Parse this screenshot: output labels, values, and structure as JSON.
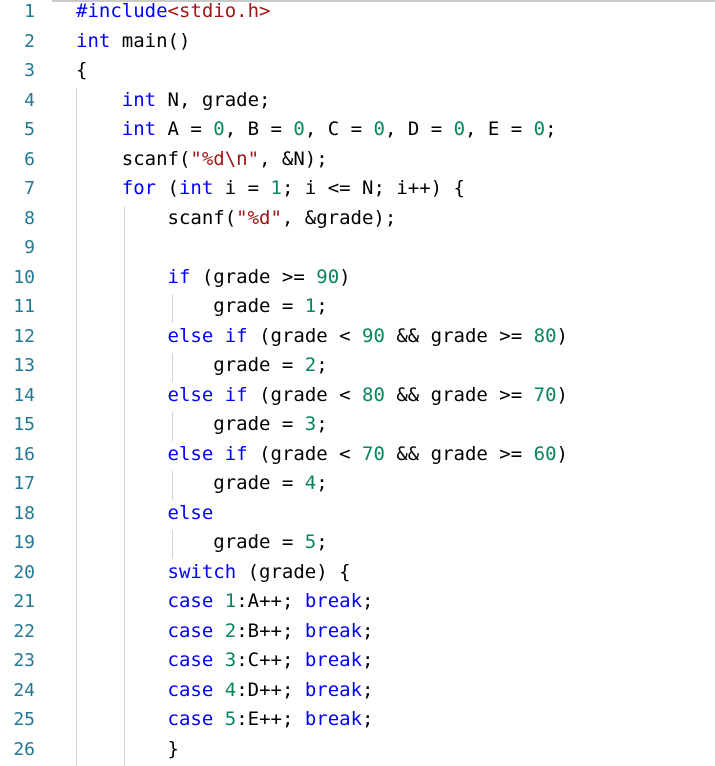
{
  "editor": {
    "lines": [
      {
        "n": "1",
        "tokens": [
          {
            "t": "#include",
            "c": "pp"
          },
          {
            "t": "<stdio.h>",
            "c": "str"
          }
        ]
      },
      {
        "n": "2",
        "tokens": [
          {
            "t": "int",
            "c": "kw"
          },
          {
            "t": " main()",
            "c": "fn"
          }
        ]
      },
      {
        "n": "3",
        "tokens": [
          {
            "t": "{",
            "c": "fn"
          }
        ]
      },
      {
        "n": "4",
        "tokens": [
          {
            "t": "    ",
            "c": "fn"
          },
          {
            "t": "int",
            "c": "kw"
          },
          {
            "t": " N, grade;",
            "c": "fn"
          }
        ]
      },
      {
        "n": "5",
        "tokens": [
          {
            "t": "    ",
            "c": "fn"
          },
          {
            "t": "int",
            "c": "kw"
          },
          {
            "t": " A = ",
            "c": "fn"
          },
          {
            "t": "0",
            "c": "num"
          },
          {
            "t": ", B = ",
            "c": "fn"
          },
          {
            "t": "0",
            "c": "num"
          },
          {
            "t": ", C = ",
            "c": "fn"
          },
          {
            "t": "0",
            "c": "num"
          },
          {
            "t": ", D = ",
            "c": "fn"
          },
          {
            "t": "0",
            "c": "num"
          },
          {
            "t": ", E = ",
            "c": "fn"
          },
          {
            "t": "0",
            "c": "num"
          },
          {
            "t": ";",
            "c": "fn"
          }
        ]
      },
      {
        "n": "6",
        "tokens": [
          {
            "t": "    scanf(",
            "c": "fn"
          },
          {
            "t": "\"%d\\n\"",
            "c": "str"
          },
          {
            "t": ", &N);",
            "c": "fn"
          }
        ]
      },
      {
        "n": "7",
        "tokens": [
          {
            "t": "    ",
            "c": "fn"
          },
          {
            "t": "for",
            "c": "kw"
          },
          {
            "t": " (",
            "c": "fn"
          },
          {
            "t": "int",
            "c": "kw"
          },
          {
            "t": " i = ",
            "c": "fn"
          },
          {
            "t": "1",
            "c": "num"
          },
          {
            "t": "; i <= N; i++) {",
            "c": "fn"
          }
        ]
      },
      {
        "n": "8",
        "tokens": [
          {
            "t": "        scanf(",
            "c": "fn"
          },
          {
            "t": "\"%d\"",
            "c": "str"
          },
          {
            "t": ", &grade);",
            "c": "fn"
          }
        ]
      },
      {
        "n": "9",
        "tokens": []
      },
      {
        "n": "10",
        "tokens": [
          {
            "t": "        ",
            "c": "fn"
          },
          {
            "t": "if",
            "c": "kw"
          },
          {
            "t": " (grade >= ",
            "c": "fn"
          },
          {
            "t": "90",
            "c": "num"
          },
          {
            "t": ")",
            "c": "fn"
          }
        ]
      },
      {
        "n": "11",
        "tokens": [
          {
            "t": "            grade = ",
            "c": "fn"
          },
          {
            "t": "1",
            "c": "num"
          },
          {
            "t": ";",
            "c": "fn"
          }
        ]
      },
      {
        "n": "12",
        "tokens": [
          {
            "t": "        ",
            "c": "fn"
          },
          {
            "t": "else",
            "c": "kw"
          },
          {
            "t": " ",
            "c": "fn"
          },
          {
            "t": "if",
            "c": "kw"
          },
          {
            "t": " (grade < ",
            "c": "fn"
          },
          {
            "t": "90",
            "c": "num"
          },
          {
            "t": " && grade >= ",
            "c": "fn"
          },
          {
            "t": "80",
            "c": "num"
          },
          {
            "t": ")",
            "c": "fn"
          }
        ]
      },
      {
        "n": "13",
        "tokens": [
          {
            "t": "            grade = ",
            "c": "fn"
          },
          {
            "t": "2",
            "c": "num"
          },
          {
            "t": ";",
            "c": "fn"
          }
        ]
      },
      {
        "n": "14",
        "tokens": [
          {
            "t": "        ",
            "c": "fn"
          },
          {
            "t": "else",
            "c": "kw"
          },
          {
            "t": " ",
            "c": "fn"
          },
          {
            "t": "if",
            "c": "kw"
          },
          {
            "t": " (grade < ",
            "c": "fn"
          },
          {
            "t": "80",
            "c": "num"
          },
          {
            "t": " && grade >= ",
            "c": "fn"
          },
          {
            "t": "70",
            "c": "num"
          },
          {
            "t": ")",
            "c": "fn"
          }
        ]
      },
      {
        "n": "15",
        "tokens": [
          {
            "t": "            grade = ",
            "c": "fn"
          },
          {
            "t": "3",
            "c": "num"
          },
          {
            "t": ";",
            "c": "fn"
          }
        ]
      },
      {
        "n": "16",
        "tokens": [
          {
            "t": "        ",
            "c": "fn"
          },
          {
            "t": "else",
            "c": "kw"
          },
          {
            "t": " ",
            "c": "fn"
          },
          {
            "t": "if",
            "c": "kw"
          },
          {
            "t": " (grade < ",
            "c": "fn"
          },
          {
            "t": "70",
            "c": "num"
          },
          {
            "t": " && grade >= ",
            "c": "fn"
          },
          {
            "t": "60",
            "c": "num"
          },
          {
            "t": ")",
            "c": "fn"
          }
        ]
      },
      {
        "n": "17",
        "tokens": [
          {
            "t": "            grade = ",
            "c": "fn"
          },
          {
            "t": "4",
            "c": "num"
          },
          {
            "t": ";",
            "c": "fn"
          }
        ]
      },
      {
        "n": "18",
        "tokens": [
          {
            "t": "        ",
            "c": "fn"
          },
          {
            "t": "else",
            "c": "kw"
          }
        ]
      },
      {
        "n": "19",
        "tokens": [
          {
            "t": "            grade = ",
            "c": "fn"
          },
          {
            "t": "5",
            "c": "num"
          },
          {
            "t": ";",
            "c": "fn"
          }
        ]
      },
      {
        "n": "20",
        "tokens": [
          {
            "t": "        ",
            "c": "fn"
          },
          {
            "t": "switch",
            "c": "kw"
          },
          {
            "t": " (grade) {",
            "c": "fn"
          }
        ]
      },
      {
        "n": "21",
        "tokens": [
          {
            "t": "        ",
            "c": "fn"
          },
          {
            "t": "case",
            "c": "kw"
          },
          {
            "t": " ",
            "c": "fn"
          },
          {
            "t": "1",
            "c": "num"
          },
          {
            "t": ":A++; ",
            "c": "fn"
          },
          {
            "t": "break",
            "c": "kw"
          },
          {
            "t": ";",
            "c": "fn"
          }
        ]
      },
      {
        "n": "22",
        "tokens": [
          {
            "t": "        ",
            "c": "fn"
          },
          {
            "t": "case",
            "c": "kw"
          },
          {
            "t": " ",
            "c": "fn"
          },
          {
            "t": "2",
            "c": "num"
          },
          {
            "t": ":B++; ",
            "c": "fn"
          },
          {
            "t": "break",
            "c": "kw"
          },
          {
            "t": ";",
            "c": "fn"
          }
        ]
      },
      {
        "n": "23",
        "tokens": [
          {
            "t": "        ",
            "c": "fn"
          },
          {
            "t": "case",
            "c": "kw"
          },
          {
            "t": " ",
            "c": "fn"
          },
          {
            "t": "3",
            "c": "num"
          },
          {
            "t": ":C++; ",
            "c": "fn"
          },
          {
            "t": "break",
            "c": "kw"
          },
          {
            "t": ";",
            "c": "fn"
          }
        ]
      },
      {
        "n": "24",
        "tokens": [
          {
            "t": "        ",
            "c": "fn"
          },
          {
            "t": "case",
            "c": "kw"
          },
          {
            "t": " ",
            "c": "fn"
          },
          {
            "t": "4",
            "c": "num"
          },
          {
            "t": ":D++; ",
            "c": "fn"
          },
          {
            "t": "break",
            "c": "kw"
          },
          {
            "t": ";",
            "c": "fn"
          }
        ]
      },
      {
        "n": "25",
        "tokens": [
          {
            "t": "        ",
            "c": "fn"
          },
          {
            "t": "case",
            "c": "kw"
          },
          {
            "t": " ",
            "c": "fn"
          },
          {
            "t": "5",
            "c": "num"
          },
          {
            "t": ":E++; ",
            "c": "fn"
          },
          {
            "t": "break",
            "c": "kw"
          },
          {
            "t": ";",
            "c": "fn"
          }
        ]
      },
      {
        "n": "26",
        "tokens": [
          {
            "t": "        }",
            "c": "fn"
          }
        ]
      }
    ]
  },
  "colors": {
    "keyword": "#0000ff",
    "string": "#a31515",
    "number": "#098658",
    "line_number": "#237893",
    "indent_guide": "#d3d3d3"
  }
}
